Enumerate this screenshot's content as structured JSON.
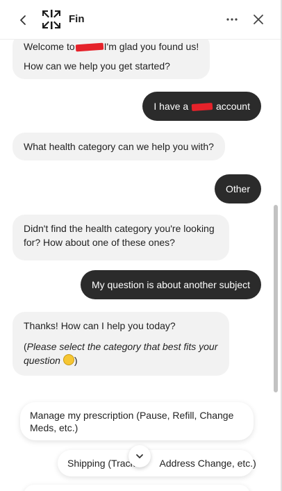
{
  "header": {
    "title": "Fin"
  },
  "messages": {
    "bot1_line1_a": "Welcome to",
    "bot1_line1_b": "I'm glad you found us!",
    "bot1_line2": "How can we help you get started?",
    "user1_a": "I have a",
    "user1_b": "account",
    "bot2": "What health category can we help you with?",
    "user2": "Other",
    "bot3": "Didn't find the health category you're looking for? How about one of these ones?",
    "user3": "My question is about another subject",
    "bot4": "Thanks! How can I help you today?",
    "bot4_note_open": "(",
    "bot4_note": "Please select the category that best fits your question",
    "bot4_note_close": ")"
  },
  "options": [
    "Manage my prescription (Pause, Refill, Change Meds, etc.)",
    "Shipping (Track",
    "Address Change, etc.)"
  ],
  "colors": {
    "user_bubble": "#2b2b2b",
    "bot_bubble": "#f2f2f2",
    "redaction": "#e5222a"
  }
}
